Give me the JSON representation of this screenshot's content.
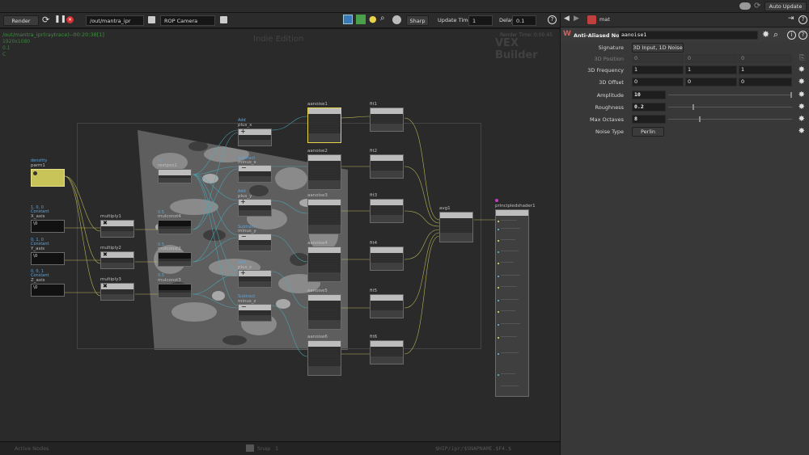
{
  "topbar": {
    "auto_update": "Auto Update"
  },
  "toolbar": {
    "render": "Render",
    "path": "/out/mantra_ipr",
    "camera": "ROP Camera",
    "mode": "Sharp",
    "update_time_label": "Update Time",
    "update_time": "1",
    "delay_label": "Delay",
    "delay": "0.1"
  },
  "viewport": {
    "info_path": "/out/mantra_ipr(raytrace)--00:20:38[1]",
    "info_res": "1920x1080",
    "info_frame": "0.1",
    "info_c": "C",
    "edition": "Indie Edition",
    "render_time": "Render Time: 0:00:45",
    "vex_builder": "VEX Builder"
  },
  "status": {
    "active_nodes": "Active Nodes",
    "snap_label": "Snap",
    "snap_value": "1",
    "hip": "$HIP/ipr/$SNAPNAME.$F4.$"
  },
  "panel": {
    "path": "mat",
    "node_type": "Anti-Aliased Noise",
    "node_name": "aanoise1"
  },
  "params": {
    "signature_label": "Signature",
    "signature": "3D Input, 1D Noise",
    "position_label": "3D Position",
    "position": [
      "0",
      "0",
      "0"
    ],
    "frequency_label": "3D Frequency",
    "frequency": [
      "1",
      "1",
      "1"
    ],
    "offset_label": "3D Offset",
    "offset": [
      "0",
      "0",
      "0"
    ],
    "amplitude_label": "Amplitude",
    "amplitude": "10",
    "roughness_label": "Roughness",
    "roughness": "0.2",
    "octaves_label": "Max Octaves",
    "octaves": "8",
    "noisetype_label": "Noise Type",
    "noisetype": "Perlin"
  },
  "nodes": {
    "parm1": {
      "label": "parm1",
      "op": "densitty"
    },
    "xaxis": {
      "label": "X_axis",
      "op": "Constant",
      "val": "1, 0, 0",
      "field": "\\0"
    },
    "yaxis": {
      "label": "Y_axis",
      "op": "Constant",
      "val": "0, 1, 0",
      "field": "\\0"
    },
    "zaxis": {
      "label": "Z_axis",
      "op": "Constant",
      "val": "0, 0, 1",
      "field": "\\0"
    },
    "mul1": "multiply1",
    "mul2": "multiply2",
    "mul3": "multiply3",
    "restpos1": {
      "label": "restpos1",
      "op": "rs"
    },
    "mc4": {
      "label": "mulconst4",
      "op": "0.5"
    },
    "mc2": {
      "label": "mulconst2",
      "op": "0.5"
    },
    "mc3": {
      "label": "mulconst3",
      "op": "0.5"
    },
    "plus_x": {
      "label": "plus_x",
      "op": "Add"
    },
    "minus_x": {
      "label": "minus_x",
      "op": "Subtract"
    },
    "plus_y": {
      "label": "plus_y",
      "op": "Add"
    },
    "minus_y": {
      "label": "minus_y",
      "op": "Subtract"
    },
    "plus_z": {
      "label": "plus_z",
      "op": "Add"
    },
    "minus_z": {
      "label": "minus_z",
      "op": "Subtract"
    },
    "aanoise": [
      "aanoise1",
      "aanoise2",
      "aanoise3",
      "aanoise4",
      "aanoise5",
      "aanoise6"
    ],
    "fit": [
      "fit1",
      "fit2",
      "fit3",
      "fit4",
      "fit5",
      "fit6"
    ],
    "avg1": "avg1",
    "principled": "principledshader1"
  }
}
